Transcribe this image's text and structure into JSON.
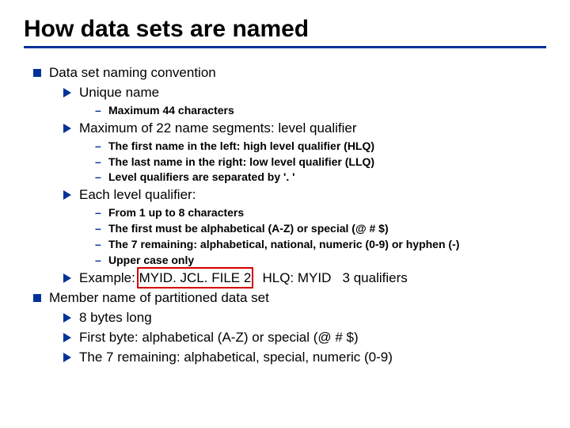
{
  "title": "How data sets are named",
  "bullets": {
    "b1": "Data set naming convention",
    "b1_1": "Unique name",
    "b1_1_1": "Maximum 44 characters",
    "b1_2": "Maximum of 22 name segments: level qualifier",
    "b1_2_1": "The first name in the left: high level qualifier (HLQ)",
    "b1_2_2": "The last name in the right: low level qualifier (LLQ)",
    "b1_2_3": "Level qualifiers are separated by '. '",
    "b1_3": "Each level qualifier:",
    "b1_3_1": "From 1 up to 8 characters",
    "b1_3_2": "The first must be alphabetical (A-Z) or special (@ # $)",
    "b1_3_3": "The 7 remaining:  alphabetical, national, numeric (0-9) or hyphen  (-)",
    "b1_3_4": "Upper case only",
    "b1_4": "Example: MYID. JCL. FILE 2   HLQ: MYID   3 qualifiers",
    "b2": "Member name of partitioned data set",
    "b2_1": "8 bytes long",
    "b2_2": "First byte: alphabetical (A-Z) or special (@ # $)",
    "b2_3": "The 7 remaining:  alphabetical, special, numeric (0-9)"
  },
  "highlight": {
    "text": "MYID. JCL. FILE 2"
  },
  "colors": {
    "accent": "#003399",
    "highlight": "#d40000"
  }
}
